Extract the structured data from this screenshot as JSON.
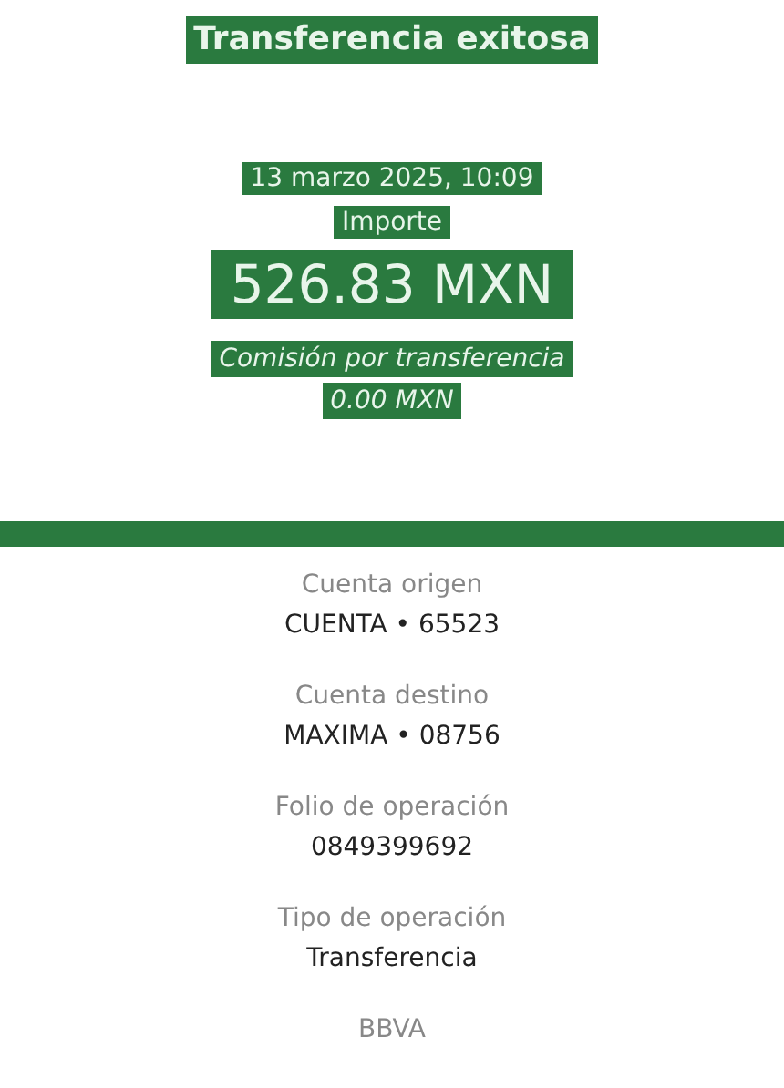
{
  "header": {
    "title": "Transferencia exitosa",
    "datetime": "13 marzo 2025, 10:09",
    "amount_label": "Importe",
    "amount": "526.83 MXN",
    "fee_label": "Comisión por transferencia",
    "fee": "0.00 MXN"
  },
  "details": [
    {
      "label": "Cuenta origen",
      "value": "CUENTA • 65523"
    },
    {
      "label": "Cuenta destino",
      "value": "MAXIMA • 08756"
    },
    {
      "label": "Folio de operación",
      "value": "0849399692"
    },
    {
      "label": "Tipo de operación",
      "value": "Transferencia"
    }
  ],
  "footer": "BBVA"
}
